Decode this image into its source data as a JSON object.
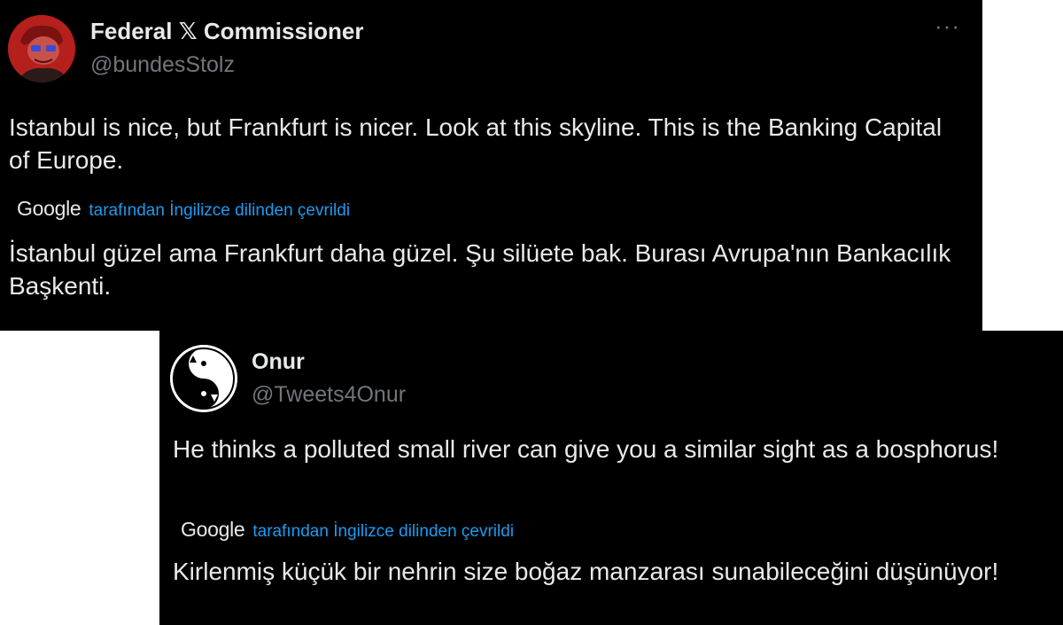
{
  "tweets": [
    {
      "author_name": "Federal 𝕏 Commissioner",
      "handle": "@bundesStolz",
      "more_label": "···",
      "text": "Istanbul is nice, but Frankfurt is nicer. Look at this skyline. This is the Banking Capital of Europe.",
      "translation_provider": "Google",
      "translation_note": "tarafından İngilizce dilinden çevrildi",
      "translation": "İstanbul güzel ama Frankfurt daha güzel. Şu silüete bak. Burası Avrupa'nın Bankacılık Başkenti."
    },
    {
      "author_name": "Onur",
      "handle": "@Tweets4Onur",
      "text": "He thinks a polluted small river can give you a similar sight as a bosphorus!",
      "translation_provider": "Google",
      "translation_note": "tarafından İngilizce dilinden çevrildi",
      "translation": "Kirlenmiş küçük bir nehrin size boğaz manzarası sunabileceğini düşünüyor!"
    }
  ],
  "colors": {
    "background": "#000000",
    "text": "#e7e9ea",
    "muted": "#71767b",
    "link": "#1d9bf0",
    "avatar_red": "#b51f1c"
  },
  "icons": {
    "tweet1_avatar": "cartoon-avatar-icon",
    "tweet2_avatar": "yin-yang-cats-icon",
    "more": "more-options-icon"
  }
}
